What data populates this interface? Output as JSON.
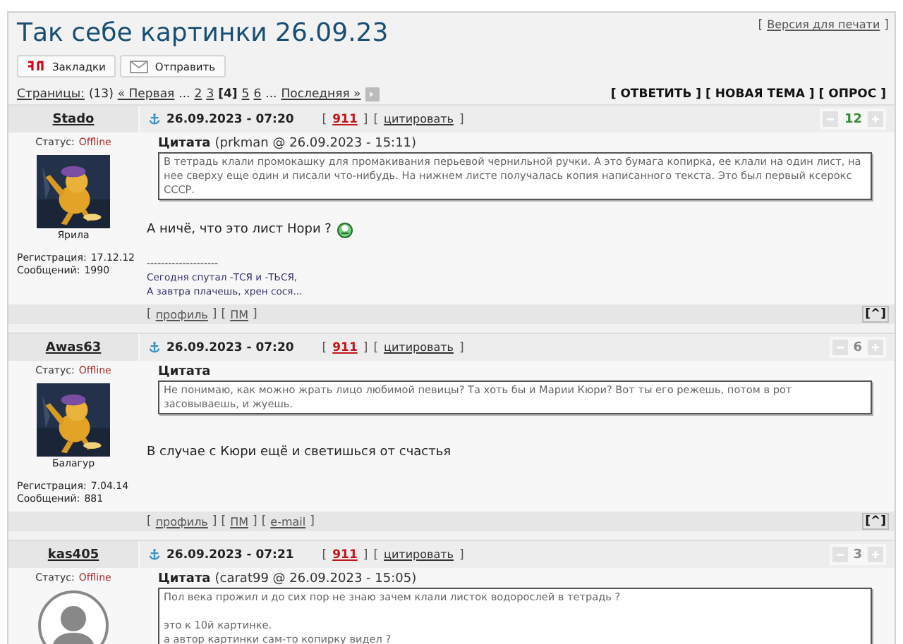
{
  "page_title": "Так себе картинки 26.09.23",
  "print_link": "Версия для печати",
  "brackets": {
    "open": "[",
    "close": "]"
  },
  "share_buttons": [
    {
      "kind": "bookmarks",
      "label": "Закладки"
    },
    {
      "kind": "send",
      "label": "Отправить"
    }
  ],
  "pagination": {
    "label": "Страницы:",
    "count": "(13)",
    "items": [
      {
        "kind": "link",
        "text": "« Первая"
      },
      {
        "kind": "text",
        "text": "..."
      },
      {
        "kind": "link",
        "text": "2"
      },
      {
        "kind": "link",
        "text": "3"
      },
      {
        "kind": "current",
        "text": "[4]"
      },
      {
        "kind": "link",
        "text": "5"
      },
      {
        "kind": "link",
        "text": "6"
      },
      {
        "kind": "text",
        "text": "..."
      },
      {
        "kind": "link",
        "text": "Последняя »"
      }
    ]
  },
  "actions": [
    "[ ОТВЕТИТЬ ]",
    "[ НОВАЯ ТЕМА ]",
    "[ ОПРОС ]"
  ],
  "posts": [
    {
      "author": "Stado",
      "date": "26.09.2023 - 07:20",
      "post_number": "911",
      "quote_link": "цитировать",
      "rating": "12",
      "rating_positive": true,
      "status_label": "Статус:",
      "status": "Offline",
      "avatar": {
        "kind": "picture"
      },
      "rank": "Ярила",
      "registered_label": "Регистрация:",
      "registered": "17.12.12",
      "messages_label": "Сообщений:",
      "messages": "1990",
      "quote": {
        "title": "Цитата",
        "source": "(prkman @ 26.09.2023 - 15:11)",
        "paragraphs": [
          "В тетрадь клали промокашку для промакивания перьевой чернильной ручки. А это бумага копирка, ее клали на один лист, на нее сверху еще один и писали что-нибудь. На нижнем листе получалась копия написанного текста. Это был первый ксерокс СССР."
        ]
      },
      "body": "А ничё, что это лист Нори ?",
      "smiley": true,
      "signature_rule": "--------------------",
      "signature": [
        "Сегодня спутал -ТСЯ и -ТЬСЯ,",
        "А завтра плачешь, хрен сося..."
      ],
      "footer_links": [
        "профиль",
        "ПМ"
      ],
      "top_button": "[^]"
    },
    {
      "author": "Awas63",
      "date": "26.09.2023 - 07:20",
      "post_number": "911",
      "quote_link": "цитировать",
      "rating": "6",
      "rating_positive": false,
      "status_label": "Статус:",
      "status": "Offline",
      "avatar": {
        "kind": "picture"
      },
      "rank": "Балагур",
      "registered_label": "Регистрация:",
      "registered": "7.04.14",
      "messages_label": "Сообщений:",
      "messages": "881",
      "quote": {
        "title": "Цитата",
        "paragraphs": [
          "Не понимаю, как можно жрать лицо любимой певицы? Та хоть бы и Марии Кюри? Вот ты его режешь, потом в рот засовываешь, и жуешь."
        ]
      },
      "body": "В случае с Кюри ещё и светишься от счастья",
      "smiley": false,
      "footer_links": [
        "профиль",
        "ПМ",
        "e-mail"
      ],
      "top_button": "[^]"
    },
    {
      "author": "kas405",
      "date": "26.09.2023 - 07:21",
      "post_number": "911",
      "quote_link": "цитировать",
      "rating": "3",
      "rating_positive": false,
      "status_label": "Статус:",
      "status": "Offline",
      "avatar": {
        "kind": "default"
      },
      "quote": {
        "title": "Цитата",
        "source": "(carat99 @ 26.09.2023 - 15:05)",
        "paragraphs": [
          "Пол века прожил и до сих пор не знаю зачем клали листок водорослей в тетрадь ?",
          "это к 10й картинке.\nа автор картинки сам-то копирку видел ?"
        ]
      }
    }
  ]
}
